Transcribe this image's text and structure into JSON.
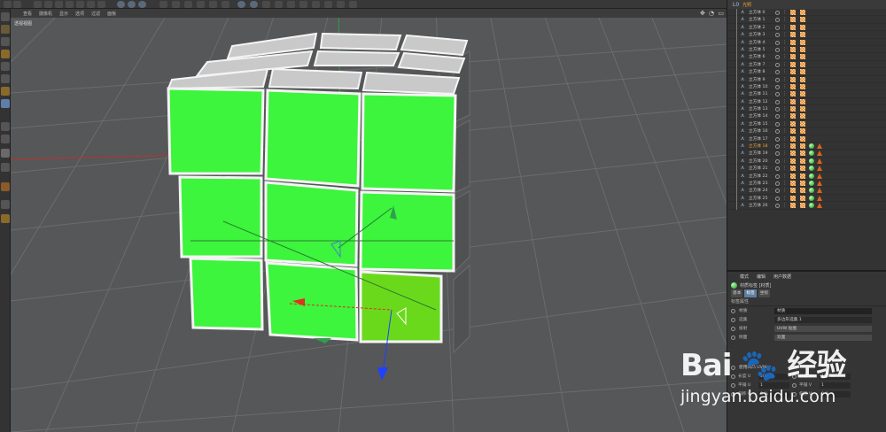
{
  "viewport": {
    "menu": [
      "查看",
      "摄像机",
      "显示",
      "选项",
      "过滤",
      "面板"
    ],
    "label": "透视视图",
    "nav_icons": "✥ ◔ ▭"
  },
  "object_manager": {
    "root_name": "光照",
    "rows": [
      "立方体 0",
      "立方体 1",
      "立方体 2",
      "立方体 3",
      "立方体 4",
      "立方体 5",
      "立方体 6",
      "立方体 7",
      "立方体 8",
      "立方体 9",
      "立方体 10",
      "立方体 11",
      "立方体 12",
      "立方体 13",
      "立方体 14",
      "立方体 15",
      "立方体 16",
      "立方体 17",
      "立方体 18",
      "立方体 19",
      "立方体 20",
      "立方体 21",
      "立方体 22",
      "立方体 23",
      "立方体 24",
      "立方体 25",
      "立方体 26"
    ],
    "highlight_index": 18,
    "material_from_index": 18
  },
  "attributes": {
    "menu": [
      "模式",
      "编辑",
      "用户数据"
    ],
    "title": "材质标签 [材质]",
    "tabs": [
      "基本",
      "标签",
      "坐标"
    ],
    "active_tab": 1,
    "section": "标签属性",
    "fields": [
      {
        "label": "材质",
        "value": "材质"
      },
      {
        "label": "选集",
        "value": "多边形选集.1"
      },
      {
        "label": "投射",
        "value": "UVW 贴图"
      },
      {
        "label": "侧面",
        "value": "双面"
      }
    ],
    "uvw_checkbox": "使用凹凸 UVW ✓",
    "numbers": [
      {
        "l1": "长度 U",
        "v1": "100 %",
        "l2": "长度 V",
        "v2": "100 %"
      },
      {
        "l1": "平铺 U",
        "v1": "1",
        "l2": "平铺 V",
        "v2": "1"
      },
      {
        "l1": "偏移 U",
        "v1": "0 %",
        "l2": "偏移 V",
        "v2": "0 %"
      }
    ]
  },
  "watermark": {
    "logo": "Bai 🐾 经验",
    "url": "jingyan.baidu.com"
  },
  "colors": {
    "face_green": "#3cf53c",
    "face_selected": "#6bd91b",
    "top_gray": "#c9c9c9",
    "axis_x": "#e03020",
    "axis_y": "#30b040",
    "axis_z": "#2040ff"
  }
}
